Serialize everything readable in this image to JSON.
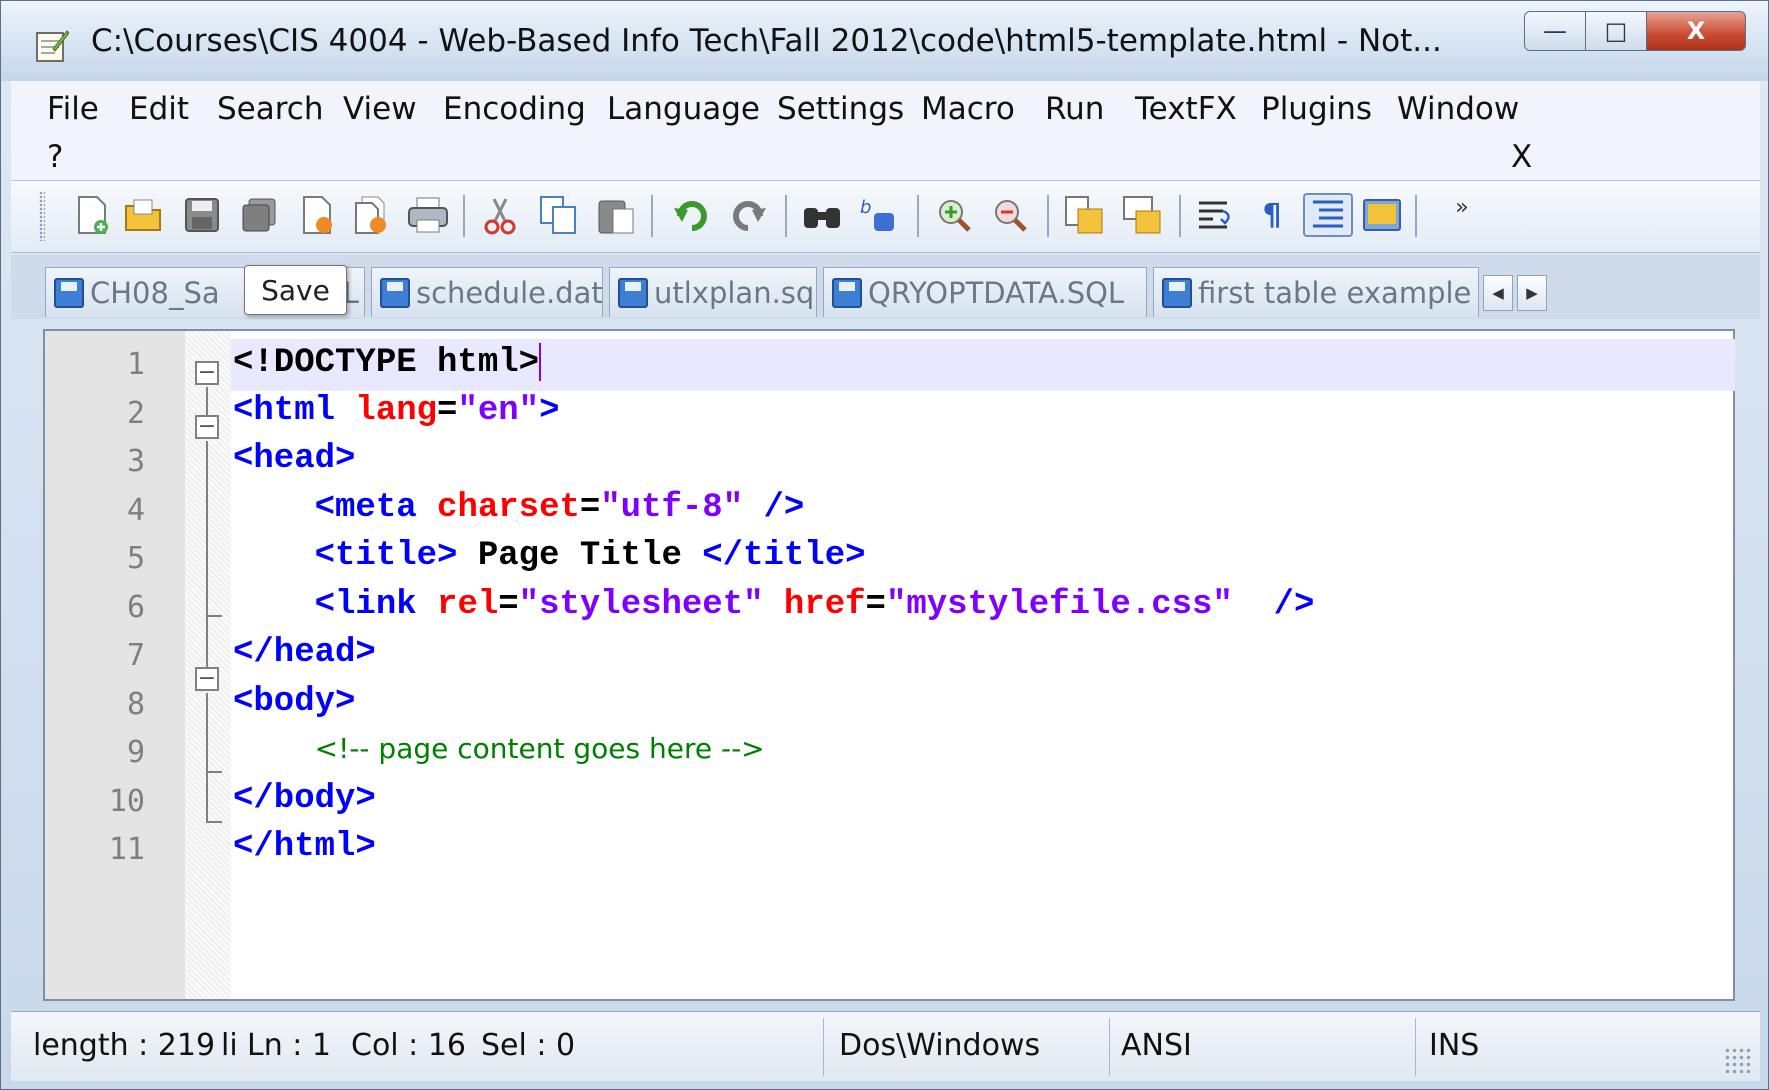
{
  "window": {
    "title": "C:\\Courses\\CIS 4004 - Web-Based Info Tech\\Fall 2012\\code\\html5-template.html - Not...",
    "controls": {
      "minimize": "—",
      "maximize": "□",
      "close": "X"
    }
  },
  "menu": {
    "items": [
      "File",
      "Edit",
      "Search",
      "View",
      "Encoding",
      "Language",
      "Settings",
      "Macro",
      "Run",
      "TextFX",
      "Plugins",
      "Window"
    ],
    "help": "?",
    "close_doc": "X"
  },
  "toolbar": {
    "icons": [
      "new-file-icon",
      "open-file-icon",
      "save-icon",
      "save-all-icon",
      "close-icon",
      "close-all-icon",
      "print-icon",
      "cut-icon",
      "copy-icon",
      "paste-icon",
      "undo-icon",
      "redo-icon",
      "find-icon",
      "replace-icon",
      "zoom-in-icon",
      "zoom-out-icon",
      "sync-vertical-icon",
      "sync-horizontal-icon",
      "word-wrap-icon",
      "show-all-chars-icon",
      "indent-guide-icon",
      "user-define-icon",
      "overflow-chevron-icon"
    ],
    "tooltip": "Save"
  },
  "tabs": [
    "CH08_Sa",
    "QL",
    "schedule.dat",
    "utlxplan.sql",
    "QRYOPTDATA.SQL",
    "first table example - w"
  ],
  "tab_scroll": {
    "left": "◀",
    "right": "▶"
  },
  "editor": {
    "lines": [
      {
        "n": "1",
        "segments": [
          {
            "t": "<!DOCTYPE html>",
            "c": "c-doc"
          }
        ]
      },
      {
        "n": "2",
        "segments": [
          {
            "t": "<html ",
            "c": "c-tag"
          },
          {
            "t": "lang",
            "c": "c-attr"
          },
          {
            "t": "=",
            "c": "c-txt"
          },
          {
            "t": "\"en\"",
            "c": "c-str"
          },
          {
            "t": ">",
            "c": "c-tag"
          }
        ]
      },
      {
        "n": "3",
        "segments": [
          {
            "t": "<head>",
            "c": "c-tag"
          }
        ]
      },
      {
        "n": "4",
        "segments": [
          {
            "t": "    <meta ",
            "c": "c-tag"
          },
          {
            "t": "charset",
            "c": "c-attr"
          },
          {
            "t": "=",
            "c": "c-txt"
          },
          {
            "t": "\"utf-8\"",
            "c": "c-str"
          },
          {
            "t": " />",
            "c": "c-tag"
          }
        ]
      },
      {
        "n": "5",
        "segments": [
          {
            "t": "    <title>",
            "c": "c-tag"
          },
          {
            "t": " Page Title ",
            "c": "c-txt"
          },
          {
            "t": "</title>",
            "c": "c-tag"
          }
        ]
      },
      {
        "n": "6",
        "segments": [
          {
            "t": "    <link ",
            "c": "c-tag"
          },
          {
            "t": "rel",
            "c": "c-attr"
          },
          {
            "t": "=",
            "c": "c-txt"
          },
          {
            "t": "\"stylesheet\"",
            "c": "c-str"
          },
          {
            "t": " ",
            "c": "c-txt"
          },
          {
            "t": "href",
            "c": "c-attr"
          },
          {
            "t": "=",
            "c": "c-txt"
          },
          {
            "t": "\"mystylefile.css\"",
            "c": "c-str"
          },
          {
            "t": "  />",
            "c": "c-tag"
          }
        ]
      },
      {
        "n": "7",
        "segments": [
          {
            "t": "</head>",
            "c": "c-tag"
          }
        ]
      },
      {
        "n": "8",
        "segments": [
          {
            "t": "<body>",
            "c": "c-tag"
          }
        ]
      },
      {
        "n": "9",
        "segments": [
          {
            "t": "    ",
            "c": "c-txt"
          },
          {
            "t": "<!-- page content goes here -->",
            "c": "c-com"
          }
        ]
      },
      {
        "n": "10",
        "segments": [
          {
            "t": "</body>",
            "c": "c-tag"
          }
        ]
      },
      {
        "n": "11",
        "segments": [
          {
            "t": "</html>",
            "c": "c-tag"
          }
        ]
      }
    ]
  },
  "status": {
    "length": "length : 219",
    "lines_clipped": "li",
    "ln": "Ln : 1",
    "col": "Col : 16",
    "sel": "Sel : 0",
    "eol": "Dos\\Windows",
    "encoding": "ANSI",
    "mode": "INS"
  },
  "colors": {
    "tag": "#0000ff",
    "attr": "#ff0000",
    "string": "#8000ff",
    "comment": "#008000",
    "current_line": "#e8e8ff"
  }
}
